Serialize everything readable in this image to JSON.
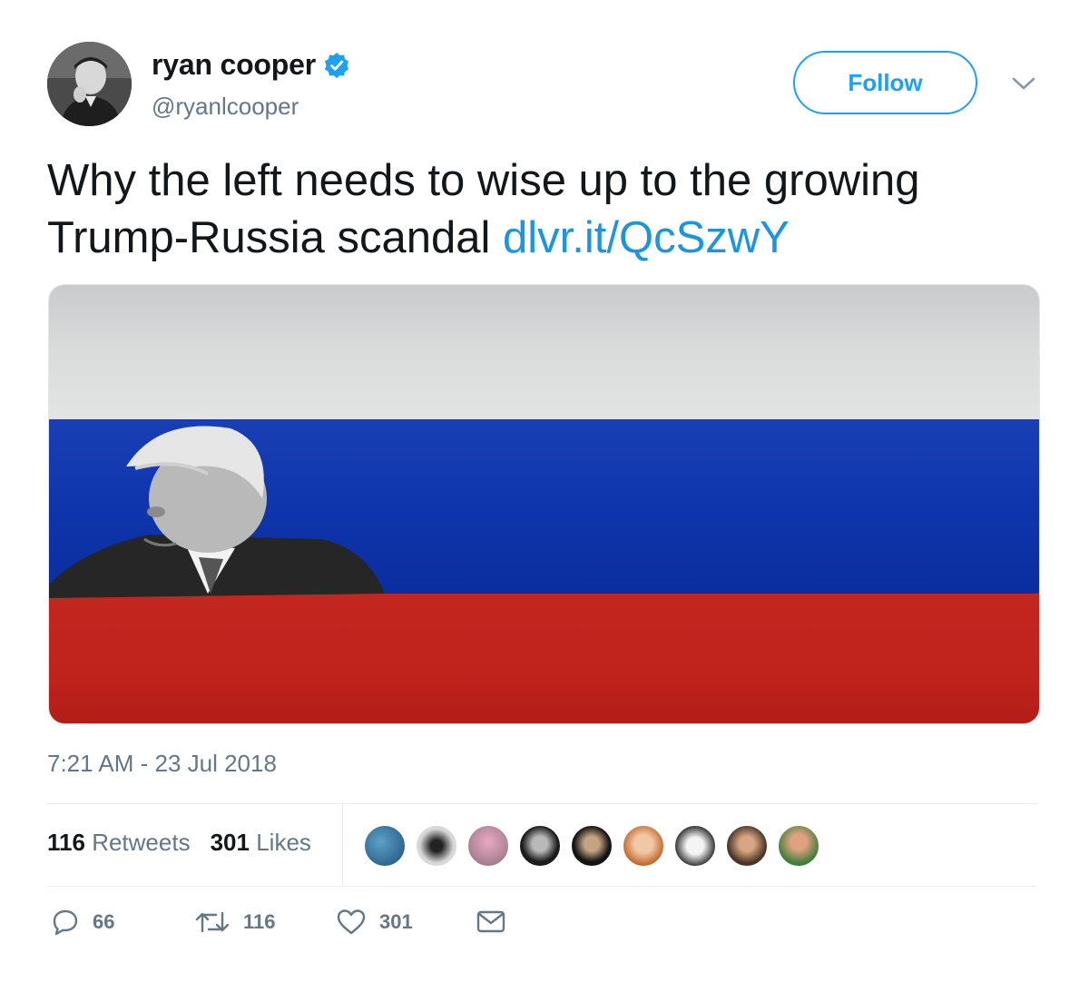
{
  "author": {
    "name": "ryan cooper",
    "handle": "@ryanlcooper",
    "verified": true,
    "follow_label": "Follow"
  },
  "tweet": {
    "text": "Why the left needs to wise up to the growing Trump-Russia scandal",
    "link_text": "dlvr.it/QcSzwY",
    "timestamp": "7:21 AM - 23 Jul 2018"
  },
  "stats": {
    "retweets_count": "116",
    "retweets_label": "Retweets",
    "likes_count": "301",
    "likes_label": "Likes"
  },
  "actions": {
    "reply_count": "66",
    "retweet_count": "116",
    "like_count": "301"
  },
  "colors": {
    "accent": "#1da1f2",
    "link": "#1b95e0",
    "muted": "#657786",
    "flag_white": "#dadcdc",
    "flag_blue": "#0f35ad",
    "flag_red": "#c0231c"
  }
}
